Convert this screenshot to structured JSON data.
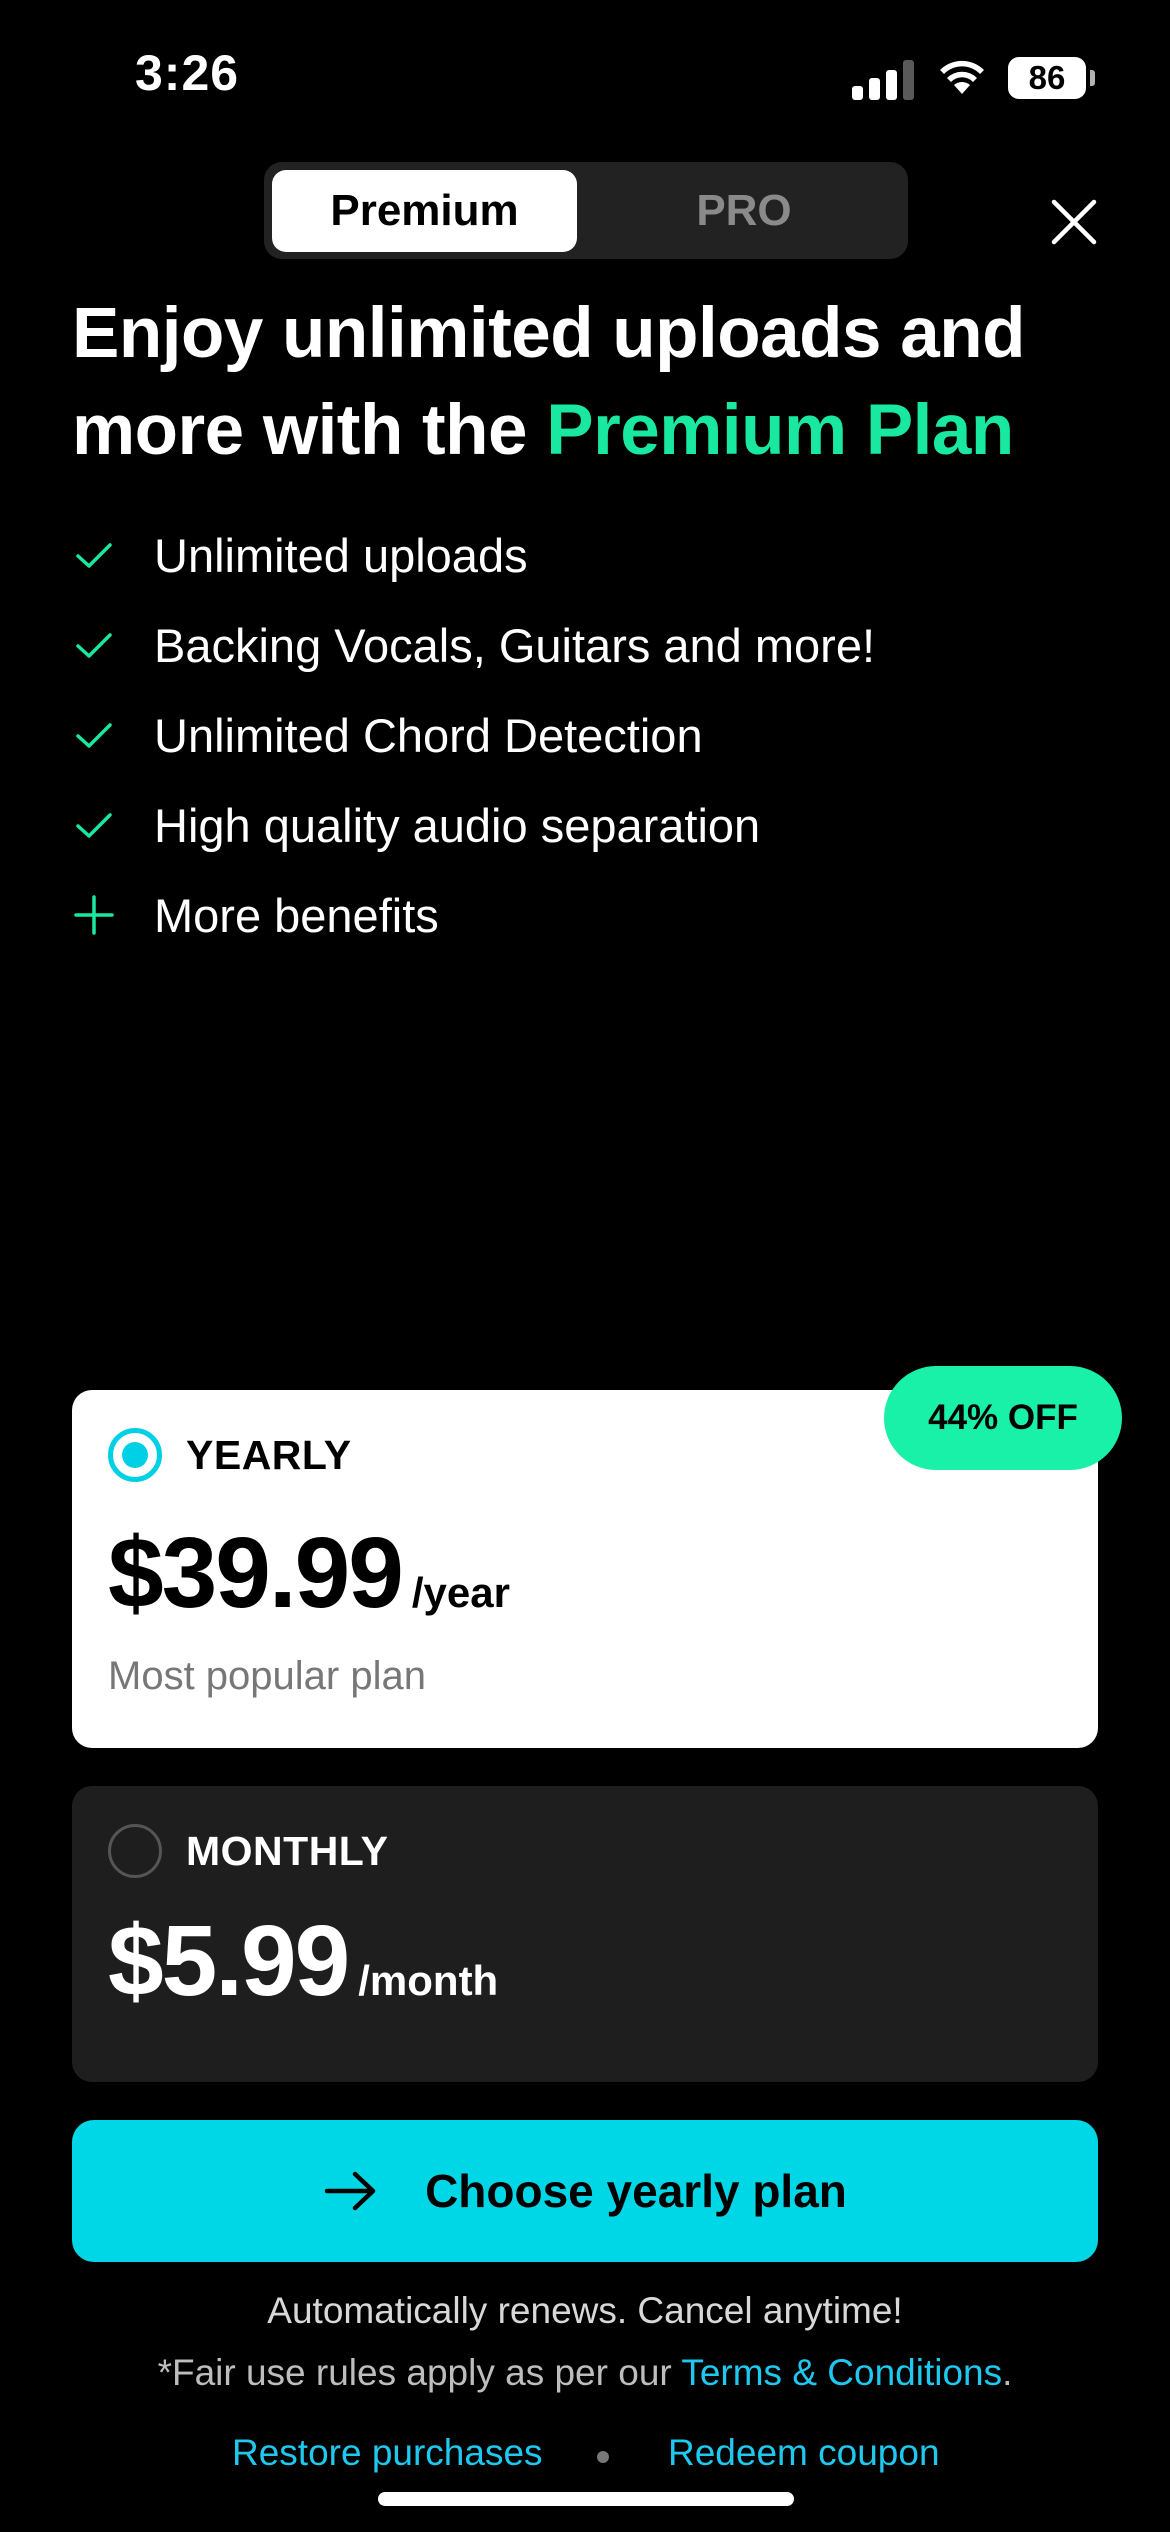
{
  "status_bar": {
    "time": "3:26",
    "battery": "86"
  },
  "segment": {
    "options": [
      "Premium",
      "PRO"
    ],
    "selected": "Premium"
  },
  "headline": {
    "line1": "Enjoy unlimited uploads and",
    "line2_prefix": "more with the ",
    "line2_accent": "Premium Plan"
  },
  "benefits": [
    {
      "icon": "check-icon",
      "label": "Unlimited uploads"
    },
    {
      "icon": "check-icon",
      "label": "Backing Vocals, Guitars and more!"
    },
    {
      "icon": "check-icon",
      "label": "Unlimited Chord Detection"
    },
    {
      "icon": "check-icon",
      "label": "High quality audio separation"
    },
    {
      "icon": "plus-icon",
      "label": "More benefits"
    }
  ],
  "plans": {
    "yearly": {
      "name": "YEARLY",
      "price": "$39.99",
      "period": "/year",
      "subtitle": "Most popular plan",
      "badge": "44% OFF",
      "selected": true
    },
    "monthly": {
      "name": "MONTHLY",
      "price": "$5.99",
      "period": "/month",
      "selected": false
    }
  },
  "cta": {
    "label": "Choose yearly plan"
  },
  "footer": {
    "renew": "Automatically renews. Cancel anytime!",
    "fair_prefix": "*Fair use rules apply as per our ",
    "fair_link": "Terms & Conditions",
    "fair_suffix": ".",
    "restore": "Restore purchases",
    "redeem": "Redeem coupon"
  },
  "colors": {
    "accent_green": "#19e8a0",
    "cta_cyan": "#00d7e6",
    "link_blue": "#1ec8ee",
    "background": "#000000"
  }
}
